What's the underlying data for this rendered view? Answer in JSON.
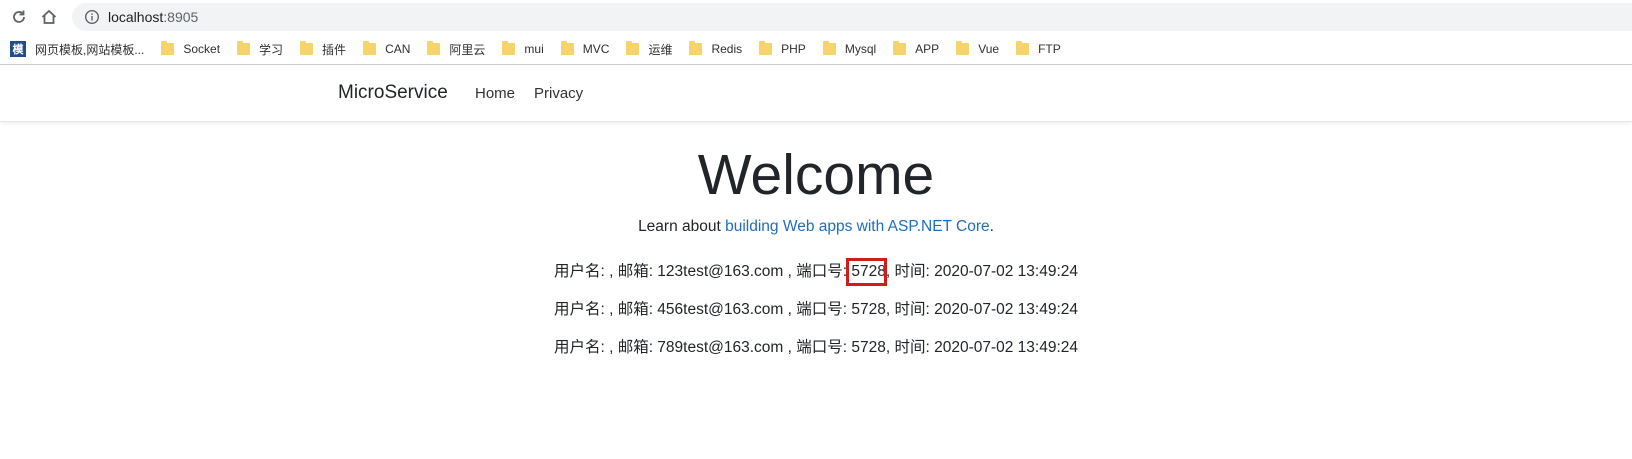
{
  "browser": {
    "url_host": "localhost",
    "url_port": ":8905"
  },
  "bookmarks": [
    {
      "label": "网页模板,网站模板...",
      "icon": "site-favicon-icon"
    },
    {
      "label": "Socket",
      "icon": "folder-icon"
    },
    {
      "label": "学习",
      "icon": "folder-icon"
    },
    {
      "label": "插件",
      "icon": "folder-icon"
    },
    {
      "label": "CAN",
      "icon": "folder-icon"
    },
    {
      "label": "阿里云",
      "icon": "folder-icon"
    },
    {
      "label": "mui",
      "icon": "folder-icon"
    },
    {
      "label": "MVC",
      "icon": "folder-icon"
    },
    {
      "label": "运维",
      "icon": "folder-icon"
    },
    {
      "label": "Redis",
      "icon": "folder-icon"
    },
    {
      "label": "PHP",
      "icon": "folder-icon"
    },
    {
      "label": "Mysql",
      "icon": "folder-icon"
    },
    {
      "label": "APP",
      "icon": "folder-icon"
    },
    {
      "label": "Vue",
      "icon": "folder-icon"
    },
    {
      "label": "FTP",
      "icon": "folder-icon"
    }
  ],
  "site": {
    "brand": "MicroService",
    "nav": [
      "Home",
      "Privacy"
    ]
  },
  "main": {
    "title": "Welcome",
    "learn_prefix": "Learn about ",
    "learn_link": "building Web apps with ASP.NET Core",
    "learn_suffix": ".",
    "rows": [
      {
        "prefix": "用户名: , 邮箱: 123test@163.com , 端口号: ",
        "port": "5728",
        "suffix": ", 时间: 2020-07-02 13:49:24"
      },
      {
        "prefix": "用户名: , 邮箱: 456test@163.com , 端口号: ",
        "port": "5728",
        "suffix": ", 时间: 2020-07-02 13:49:24"
      },
      {
        "prefix": "用户名: , 邮箱: 789test@163.com , 端口号: ",
        "port": "5728",
        "suffix": ", 时间: 2020-07-02 13:49:24"
      }
    ],
    "highlight_color": "#d21c1c",
    "link_color": "#1e6ebd"
  }
}
